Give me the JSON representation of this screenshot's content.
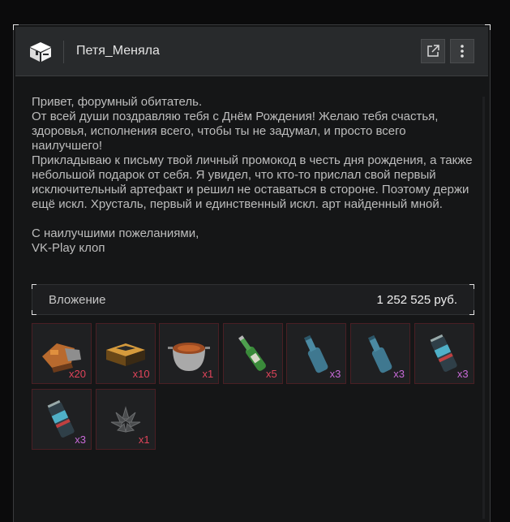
{
  "window": {
    "title": "Петя_Меняла"
  },
  "message": {
    "paragraphs": [
      "Привет, форумный обитатель.\nОт всей души поздравляю тебя с Днём Рождения! Желаю тебя счастья, здоровья, исполнения всего, чтобы ты не задумал, и просто всего наилучшего!\nПрикладываю к письму твой личный промокод в честь дня рождения, а также небольшой подарок от себя. Я увидел, что кто-то прислал свой первый исключительный артефакт и решил не оставаться в стороне. Поэтому держи ещё искл. Хрусталь, первый и единственный искл. арт найденный мной.",
      "С наилучшими пожеланиями,\nVK-Play клоп"
    ]
  },
  "attachment": {
    "label": "Вложение",
    "value": "1 252 525 руб."
  },
  "colors": {
    "qty_red": "#e0445a",
    "qty_purple": "#c86ad8",
    "item_border": "#4a1f24"
  },
  "items": [
    {
      "icon": "toolkit-orange-icon",
      "qty": "x20",
      "qty_color": "#e0445a"
    },
    {
      "icon": "toolkit-case-icon",
      "qty": "x10",
      "qty_color": "#e0445a"
    },
    {
      "icon": "stew-pot-icon",
      "qty": "x1",
      "qty_color": "#e0445a"
    },
    {
      "icon": "green-bottle-icon",
      "qty": "x5",
      "qty_color": "#e0445a"
    },
    {
      "icon": "blue-bottle-icon",
      "qty": "x3",
      "qty_color": "#c86ad8"
    },
    {
      "icon": "blue-bottle-icon",
      "qty": "x3",
      "qty_color": "#c86ad8"
    },
    {
      "icon": "energy-can-icon",
      "qty": "x3",
      "qty_color": "#c86ad8"
    },
    {
      "icon": "energy-can-icon",
      "qty": "x3",
      "qty_color": "#c86ad8"
    },
    {
      "icon": "crystal-artifact-icon",
      "qty": "x1",
      "qty_color": "#e0445a"
    }
  ]
}
